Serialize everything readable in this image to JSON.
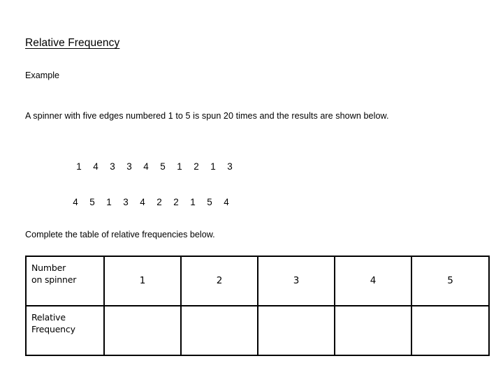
{
  "document": {
    "title": "Relative Frequency",
    "subtitle": "Example",
    "paragraph": "A spinner with five edges numbered 1 to 5 is spun 20 times and the results are shown below.",
    "instruction": "Complete the table of relative frequencies below."
  },
  "results": {
    "row1": [
      "1",
      "4",
      "3",
      "3",
      "4",
      "5",
      "1",
      "2",
      "1",
      "3"
    ],
    "row2": [
      "4",
      "5",
      "1",
      "3",
      "4",
      "2",
      "2",
      "1",
      "5",
      "4"
    ]
  },
  "table": {
    "row_header_1": "Number\non spinner",
    "row_header_2": "Relative\nFrequency",
    "spinner_numbers": [
      "1",
      "2",
      "3",
      "4",
      "5"
    ],
    "relative_frequencies": [
      "",
      "",
      "",
      "",
      ""
    ]
  },
  "colors": {
    "background": "#ffffff",
    "text": "#000000",
    "table_border": "#000000"
  }
}
